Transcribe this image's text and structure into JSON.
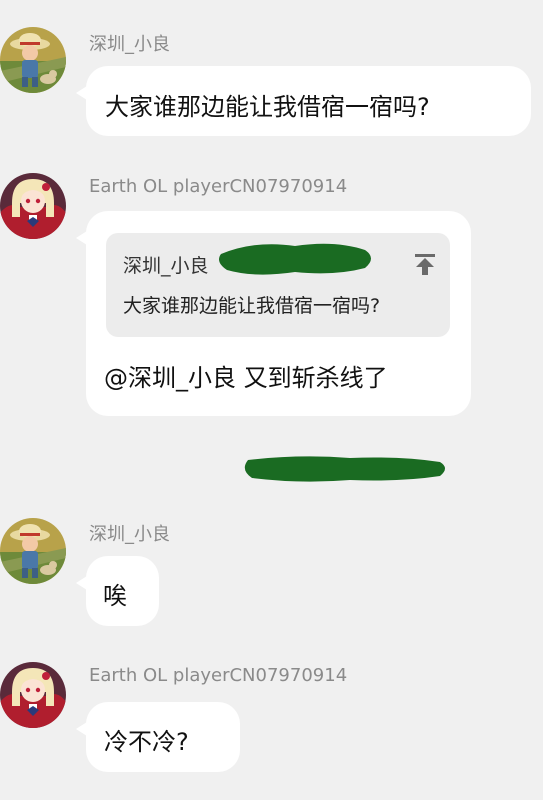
{
  "colors": {
    "background": "#f0f0f0",
    "bubble": "#ffffff",
    "quote_bg": "#ececec",
    "sender_text": "#8a8a8a",
    "redaction": "#1a6b22"
  },
  "messages": [
    {
      "sender": "深圳_小良",
      "avatar": "straw-hat-child-avatar",
      "text": "大家谁那边能让我借宿一宿吗?"
    },
    {
      "sender": "Earth OL playerCN07970914",
      "avatar": "anime-girl-avatar",
      "quote": {
        "sender": "深圳_小良",
        "text": "大家谁那边能让我借宿一宿吗?",
        "icon": "jump-to-original-icon"
      },
      "text": "@深圳_小良 又到斩杀线了"
    },
    {
      "sender": "深圳_小良",
      "avatar": "straw-hat-child-avatar",
      "text": "唉"
    },
    {
      "sender": "Earth OL playerCN07970914",
      "avatar": "anime-girl-avatar",
      "text": "冷不冷?"
    }
  ]
}
